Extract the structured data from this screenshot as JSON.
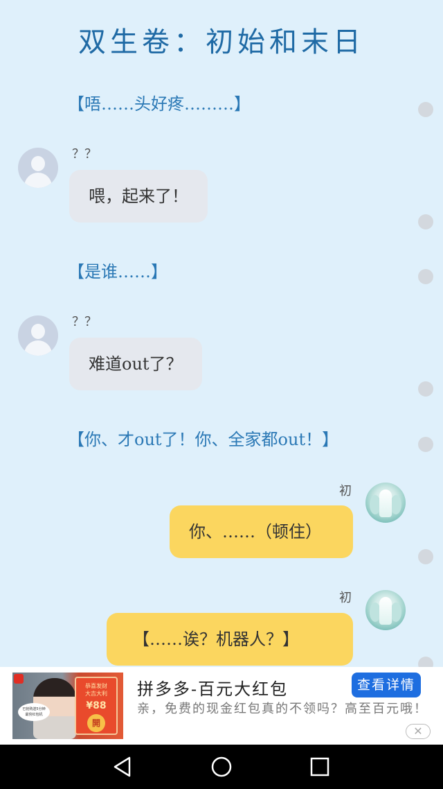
{
  "title": "双生卷：初始和末日",
  "messages": [
    {
      "type": "narration",
      "text": "【唔……头好疼………】"
    },
    {
      "type": "chat",
      "side": "left",
      "speaker": "？？",
      "text": "喂，起来了！"
    },
    {
      "type": "narration",
      "text": "【是谁……】"
    },
    {
      "type": "chat",
      "side": "left",
      "speaker": "？？",
      "text": "难道out了？"
    },
    {
      "type": "narration",
      "text": "【你、才out了！你、全家都out！】"
    },
    {
      "type": "chat",
      "side": "right",
      "speaker": "初",
      "text": "你、……（顿住）"
    },
    {
      "type": "chat",
      "side": "right",
      "speaker": "初",
      "text": "【……诶？机器人？】"
    }
  ],
  "ad": {
    "title": "拼多多-百元大红包",
    "description": "亲，免费的现金红包真的不领吗？高至百元哦！",
    "button_label": "查看详情",
    "close_glyph": "✕",
    "image": {
      "card_line1": "恭喜发财",
      "card_line2": "大吉大利",
      "card_amount": "¥88",
      "card_open": "開",
      "speech_line1": "已抢购送5分钟",
      "speech_line2": "最穷红包机"
    }
  },
  "navbar": {
    "back_icon": "back-triangle-icon",
    "home_icon": "home-circle-icon",
    "recent_icon": "recent-square-icon",
    "color": "#000000"
  },
  "colors": {
    "background": "#dff0fb",
    "title": "#1f6aa5",
    "narration": "#2a78b5",
    "left_bubble": "#e5e8ee",
    "right_bubble": "#fbd65f",
    "ad_button": "#1e6ee0"
  }
}
